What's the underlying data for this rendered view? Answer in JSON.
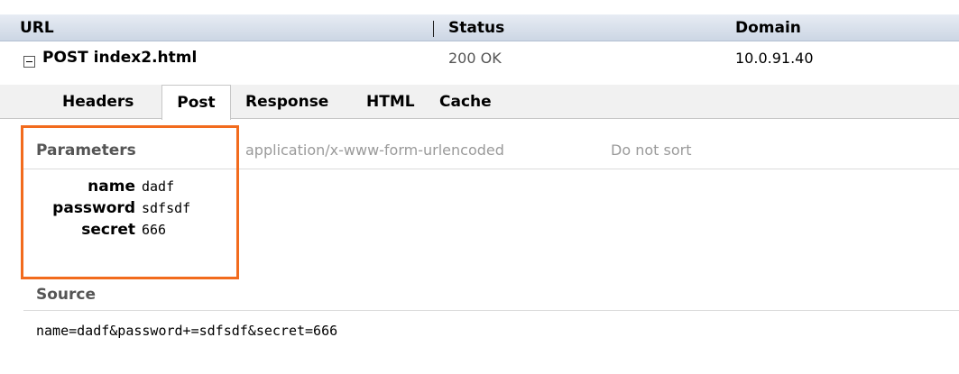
{
  "columns": {
    "url": "URL",
    "status": "Status",
    "domain": "Domain"
  },
  "request": {
    "title": "POST index2.html",
    "status": "200 OK",
    "domain": "10.0.91.40"
  },
  "tabs": [
    {
      "label": "Headers",
      "active": false
    },
    {
      "label": "Post",
      "active": true
    },
    {
      "label": "Response",
      "active": false
    },
    {
      "label": "HTML",
      "active": false
    },
    {
      "label": "Cache",
      "active": false
    }
  ],
  "parameters": {
    "title": "Parameters",
    "content_type": "application/x-www-form-urlencoded",
    "sort_label": "Do not sort",
    "rows": [
      {
        "name": "name",
        "value": "dadf"
      },
      {
        "name": "password",
        "value": "sdfsdf"
      },
      {
        "name": "secret",
        "value": "666"
      }
    ]
  },
  "source": {
    "title": "Source",
    "text": "name=dadf&password+=sdfsdf&secret=666"
  },
  "colors": {
    "highlight": "#f26b1d"
  }
}
